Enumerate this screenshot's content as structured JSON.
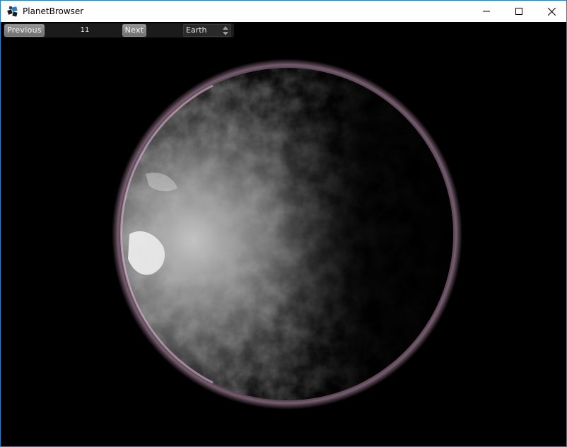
{
  "window": {
    "title": "PlanetBrowser",
    "app_icon": "planet-browser-app-icon",
    "controls": {
      "minimize_icon": "minimize-icon",
      "maximize_icon": "maximize-icon",
      "close_icon": "close-icon"
    },
    "border_color": "#1883d7"
  },
  "toolbar": {
    "previous_label": "Previous",
    "index": "11",
    "next_label": "Next",
    "planet_select": {
      "selected": "Earth",
      "icon": "up-down-arrows-icon"
    }
  },
  "viewport": {
    "background": "#000000",
    "planet": "rendered-planet",
    "atmosphere_color": "#c89ab8"
  }
}
